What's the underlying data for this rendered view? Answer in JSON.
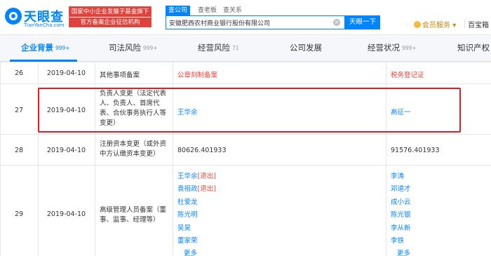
{
  "header": {
    "logo_title": "天眼查",
    "logo_url": "TianYanCha.com",
    "banner_line1": "国家中小企业发展子基金旗下",
    "banner_line2": "官方备案企业征信机构",
    "search_tabs": [
      "查公司",
      "查老板",
      "查关系"
    ],
    "search_value": "安徽肥西农村商业银行股份有限公司",
    "search_button": "天眼一下",
    "vip_label": "会员服务",
    "vip_caret": "▾",
    "baibao_label": "百宝箱"
  },
  "tabs": [
    {
      "label": "企业背景",
      "count": "999+"
    },
    {
      "label": "司法风险",
      "count": "999+"
    },
    {
      "label": "经营风险",
      "count": "71"
    },
    {
      "label": "公司发展",
      "count": ""
    },
    {
      "label": "经营状况",
      "count": "999+"
    },
    {
      "label": "知识产权",
      "count": ""
    }
  ],
  "rows": [
    {
      "index": "26",
      "date": "2019-04-10",
      "item": "其他事项备案",
      "before": "公章刻制备案",
      "after": "税务登记证"
    },
    {
      "index": "27",
      "date": "2019-04-10",
      "item": "负责人变更（法定代表人、负责人、首席代表、合伙事务执行人等变更）",
      "before": "王华余",
      "after": "高征一"
    },
    {
      "index": "28",
      "date": "2019-04-10",
      "item": "注册资本变更（或外资中方认缴资本变更）",
      "before": "80626.401933",
      "after": "91576.401933"
    },
    {
      "index": "29",
      "date": "2019-04-10",
      "item": "高级管理人员备案（董事、监事、经理等）",
      "before_list": [
        {
          "name": "王华余",
          "tag": "[退出]"
        },
        {
          "name": "袁祖政",
          "tag": "[退出]"
        },
        {
          "name": "杜爱龙",
          "tag": ""
        },
        {
          "name": "陈光明",
          "tag": ""
        },
        {
          "name": "吴昊",
          "tag": ""
        },
        {
          "name": "董家荣",
          "tag": ""
        }
      ],
      "after_list": [
        "李涛",
        "邓道才",
        "成小云",
        "陈光银",
        "李从新",
        "李铁"
      ],
      "more_label": "更多"
    }
  ],
  "colors": {
    "accent": "#0084ff",
    "red": "#e8463a",
    "highlight": "#e01e25"
  }
}
